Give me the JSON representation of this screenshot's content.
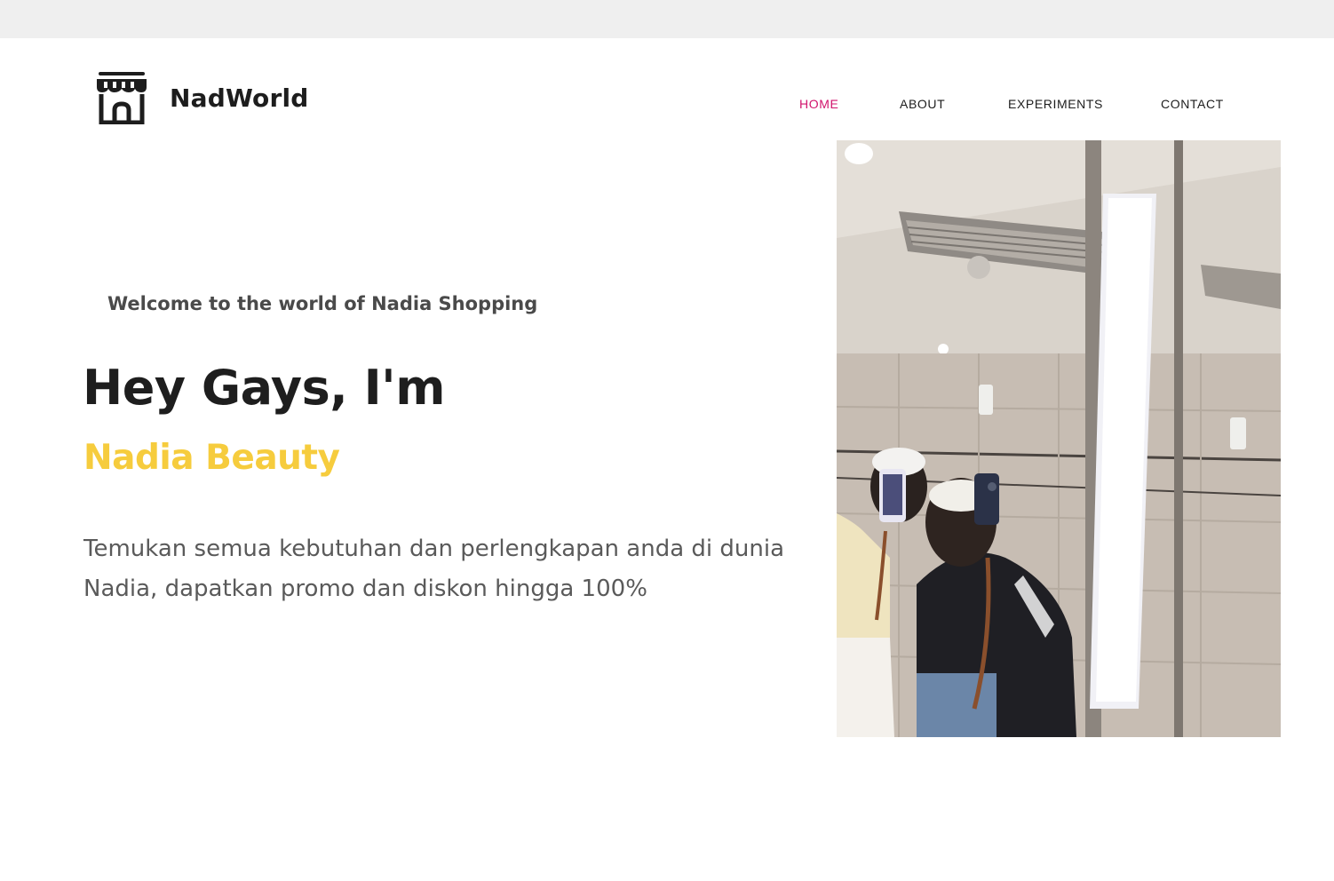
{
  "brand": {
    "name": "NadWorld",
    "logo_icon": "storefront-icon"
  },
  "nav": {
    "items": [
      {
        "label": "HOME",
        "active": true
      },
      {
        "label": "ABOUT",
        "active": false
      },
      {
        "label": "EXPERIMENTS",
        "active": false
      },
      {
        "label": "CONTACT",
        "active": false
      }
    ]
  },
  "hero": {
    "welcome": "Welcome to the world of Nadia Shopping",
    "greeting": "Hey Gays, I'm",
    "name": "Nadia Beauty",
    "description": "Temukan semua kebutuhan dan perlengkapan anda di dunia Nadia, dapatkan promo dan diskon hingga 100%"
  },
  "colors": {
    "active_nav": "#d1136c",
    "accent_name": "#f6cc3d",
    "heading": "#1e1e1e",
    "body_text": "#5a5a5a",
    "top_strip": "#efefef"
  }
}
